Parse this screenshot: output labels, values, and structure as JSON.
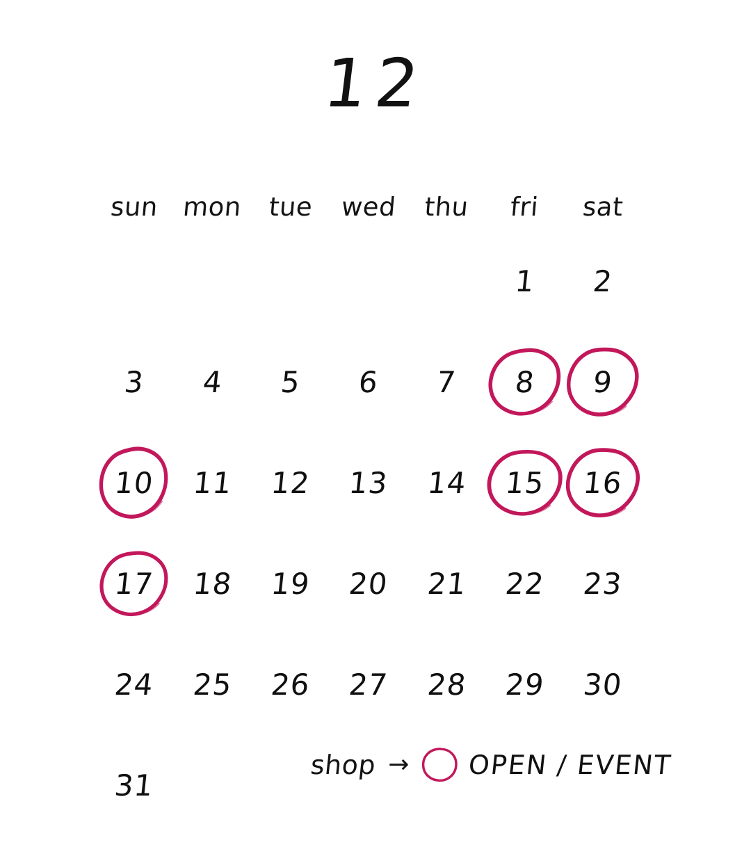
{
  "title": "12",
  "colors": {
    "ink": "#111111",
    "accent": "#C2185B",
    "background": "#FFFFFF"
  },
  "weekdays": [
    {
      "label": "sun"
    },
    {
      "label": "mon"
    },
    {
      "label": "tue"
    },
    {
      "label": "wed"
    },
    {
      "label": "thu"
    },
    {
      "label": "fri"
    },
    {
      "label": "sat"
    }
  ],
  "weeks": [
    [
      {
        "day": "",
        "circled": false
      },
      {
        "day": "",
        "circled": false
      },
      {
        "day": "",
        "circled": false
      },
      {
        "day": "",
        "circled": false
      },
      {
        "day": "",
        "circled": false
      },
      {
        "day": "1",
        "circled": false
      },
      {
        "day": "2",
        "circled": false
      }
    ],
    [
      {
        "day": "3",
        "circled": false
      },
      {
        "day": "4",
        "circled": false
      },
      {
        "day": "5",
        "circled": false
      },
      {
        "day": "6",
        "circled": false
      },
      {
        "day": "7",
        "circled": false
      },
      {
        "day": "8",
        "circled": true
      },
      {
        "day": "9",
        "circled": true
      }
    ],
    [
      {
        "day": "10",
        "circled": true
      },
      {
        "day": "11",
        "circled": false
      },
      {
        "day": "12",
        "circled": false
      },
      {
        "day": "13",
        "circled": false
      },
      {
        "day": "14",
        "circled": false
      },
      {
        "day": "15",
        "circled": true
      },
      {
        "day": "16",
        "circled": true
      }
    ],
    [
      {
        "day": "17",
        "circled": true
      },
      {
        "day": "18",
        "circled": false
      },
      {
        "day": "19",
        "circled": false
      },
      {
        "day": "20",
        "circled": false
      },
      {
        "day": "21",
        "circled": false
      },
      {
        "day": "22",
        "circled": false
      },
      {
        "day": "23",
        "circled": false
      }
    ],
    [
      {
        "day": "24",
        "circled": false
      },
      {
        "day": "25",
        "circled": false
      },
      {
        "day": "26",
        "circled": false
      },
      {
        "day": "27",
        "circled": false
      },
      {
        "day": "28",
        "circled": false
      },
      {
        "day": "29",
        "circled": false
      },
      {
        "day": "30",
        "circled": false
      }
    ],
    [
      {
        "day": "31",
        "circled": false
      },
      {
        "day": "",
        "circled": false
      },
      {
        "day": "",
        "circled": false
      },
      {
        "day": "",
        "circled": false
      },
      {
        "day": "",
        "circled": false
      },
      {
        "day": "",
        "circled": false
      },
      {
        "day": "",
        "circled": false
      }
    ]
  ],
  "legend": {
    "shop_label": "shop",
    "arrow": "→",
    "circle_icon": "circle-icon",
    "meaning": "OPEN / EVENT"
  }
}
